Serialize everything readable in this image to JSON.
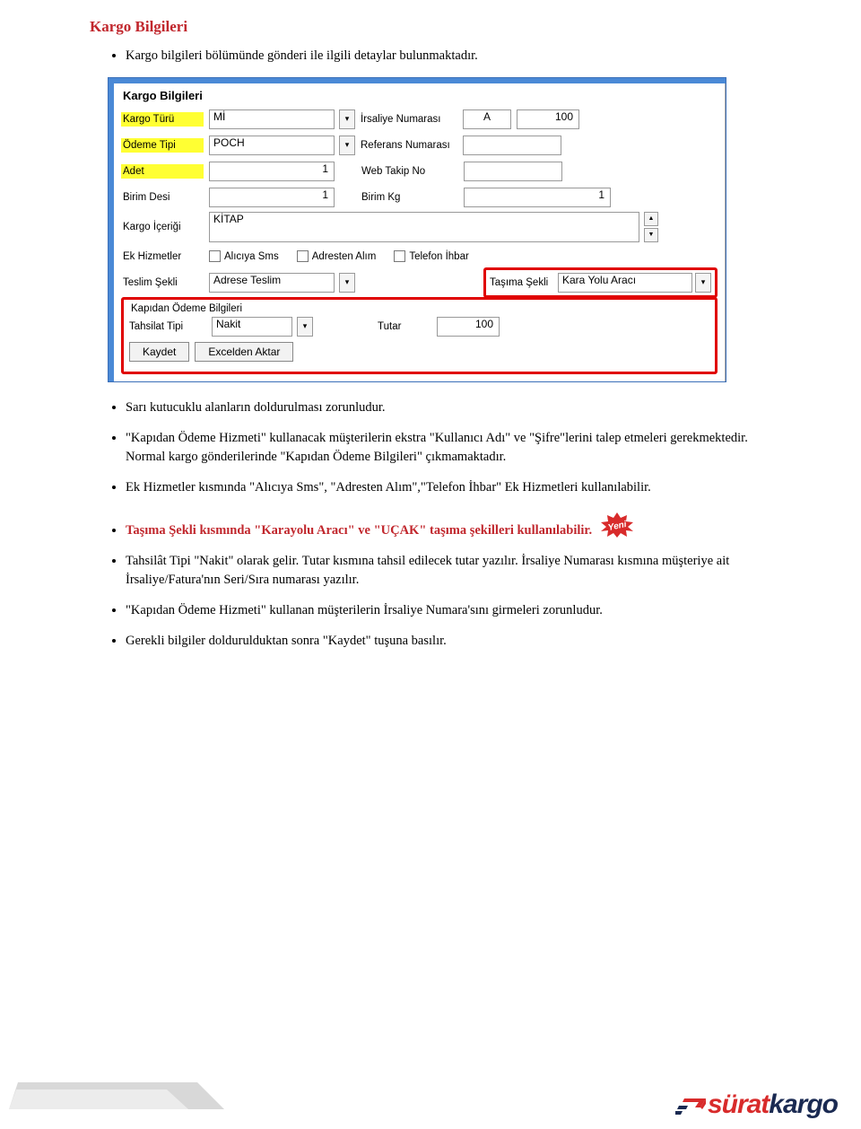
{
  "heading": "Kargo Bilgileri",
  "bullets": {
    "b1": "Kargo bilgileri bölümünde gönderi ile ilgili detaylar bulunmaktadır.",
    "b2": "Sarı kutucuklu alanların doldurulması zorunludur.",
    "b3": "\"Kapıdan Ödeme Hizmeti\" kullanacak müşterilerin ekstra \"Kullanıcı Adı\" ve \"Şifre\"lerini talep etmeleri gerekmektedir. Normal kargo gönderilerinde \"Kapıdan Ödeme Bilgileri\" çıkmamaktadır.",
    "b4": "Ek Hizmetler kısmında \"Alıcıya Sms\", \"Adresten Alım\",\"Telefon İhbar\" Ek Hizmetleri kullanılabilir.",
    "b5": "Taşıma Şekli kısmında \"Karayolu Aracı\" ve \"UÇAK\" taşıma şekilleri kullanılabilir.",
    "b6": "Tahsilât Tipi \"Nakit\" olarak gelir. Tutar kısmına tahsil edilecek tutar yazılır. İrsaliye Numarası kısmına müşteriye ait İrsaliye/Fatura'nın Seri/Sıra numarası yazılır.",
    "b7": "\"Kapıdan Ödeme Hizmeti\" kullanan müşterilerin İrsaliye Numara'sını girmeleri zorunludur.",
    "b8": "Gerekli bilgiler doldurulduktan sonra \"Kaydet\" tuşuna basılır."
  },
  "form": {
    "title": "Kargo Bilgileri",
    "labels": {
      "kargo_turu": "Kargo Türü",
      "odeme_tipi": "Ödeme Tipi",
      "adet": "Adet",
      "birim_desi": "Birim Desi",
      "kargo_icerigi": "Kargo İçeriği",
      "ek_hizmetler": "Ek Hizmetler",
      "teslim_sekli": "Teslim Şekli",
      "irsaliye_no": "İrsaliye Numarası",
      "referans_no": "Referans Numarası",
      "web_takip": "Web Takip No",
      "birim_kg": "Birim Kg",
      "tasima_sekli": "Taşıma Şekli",
      "kapidan_odeme": "Kapıdan Ödeme Bilgileri",
      "tahsilat_tipi": "Tahsilat Tipi",
      "tutar": "Tutar"
    },
    "values": {
      "kargo_turu": "Mİ",
      "odeme_tipi": "POCH",
      "adet": "1",
      "birim_desi": "1",
      "kargo_icerigi": "KİTAP",
      "teslim_sekli": "Adrese Teslim",
      "irsaliye_seri": "A",
      "irsaliye_no": "100",
      "birim_kg": "1",
      "tasima_sekli": "Kara Yolu Aracı",
      "tahsilat_tipi": "Nakit",
      "tutar": "100"
    },
    "checkboxes": {
      "aliciya_sms": "Alıcıya Sms",
      "adresten_alim": "Adresten Alım",
      "telefon_ihbar": "Telefon İhbar"
    },
    "buttons": {
      "kaydet": "Kaydet",
      "excelden_aktar": "Excelden Aktar"
    }
  },
  "badge": {
    "text": "Yeni"
  },
  "logo": {
    "part1": "sürat",
    "part2": "kargo"
  }
}
